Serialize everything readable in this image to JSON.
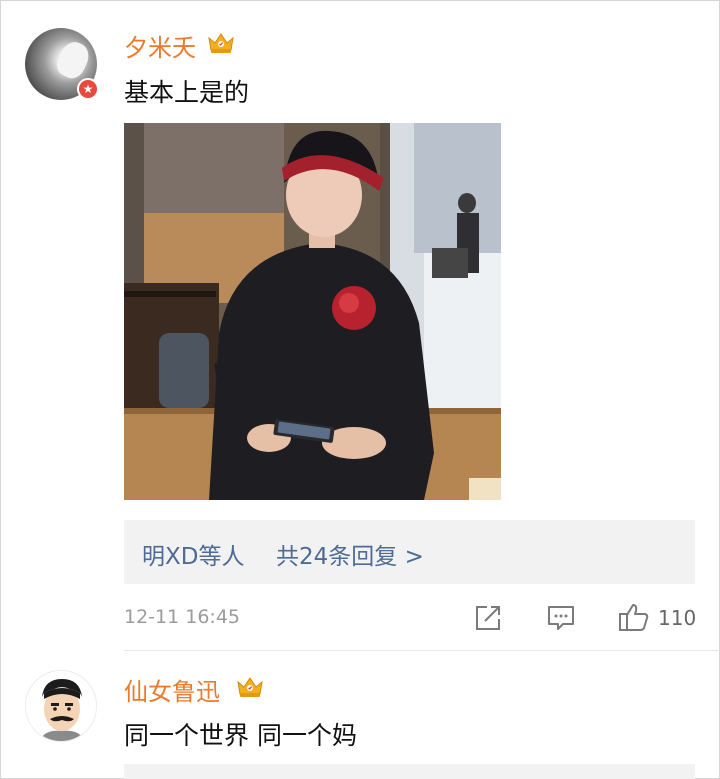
{
  "comments": [
    {
      "username": "夕米夭",
      "text": "基本上是的",
      "replies": {
        "names": "明XD等人",
        "count_label": "共24条回复 >"
      },
      "timestamp": "12-11 16:45",
      "like_count": "110",
      "avatar_badge_icon": "star-badge-icon"
    },
    {
      "username": "仙女鲁迅",
      "text": "同一个世界 同一个妈"
    }
  ],
  "icons": {
    "crown": "crown-icon",
    "share": "share-icon",
    "comment": "comment-icon",
    "like": "thumbs-up-icon"
  },
  "colors": {
    "username": "#eb7a2e",
    "reply_link": "#4e6b96",
    "meta_gray": "#9b9b9b",
    "reply_box_bg": "#f2f2f2",
    "badge_red": "#e8493d",
    "crown_gold": "#f2b01e"
  }
}
